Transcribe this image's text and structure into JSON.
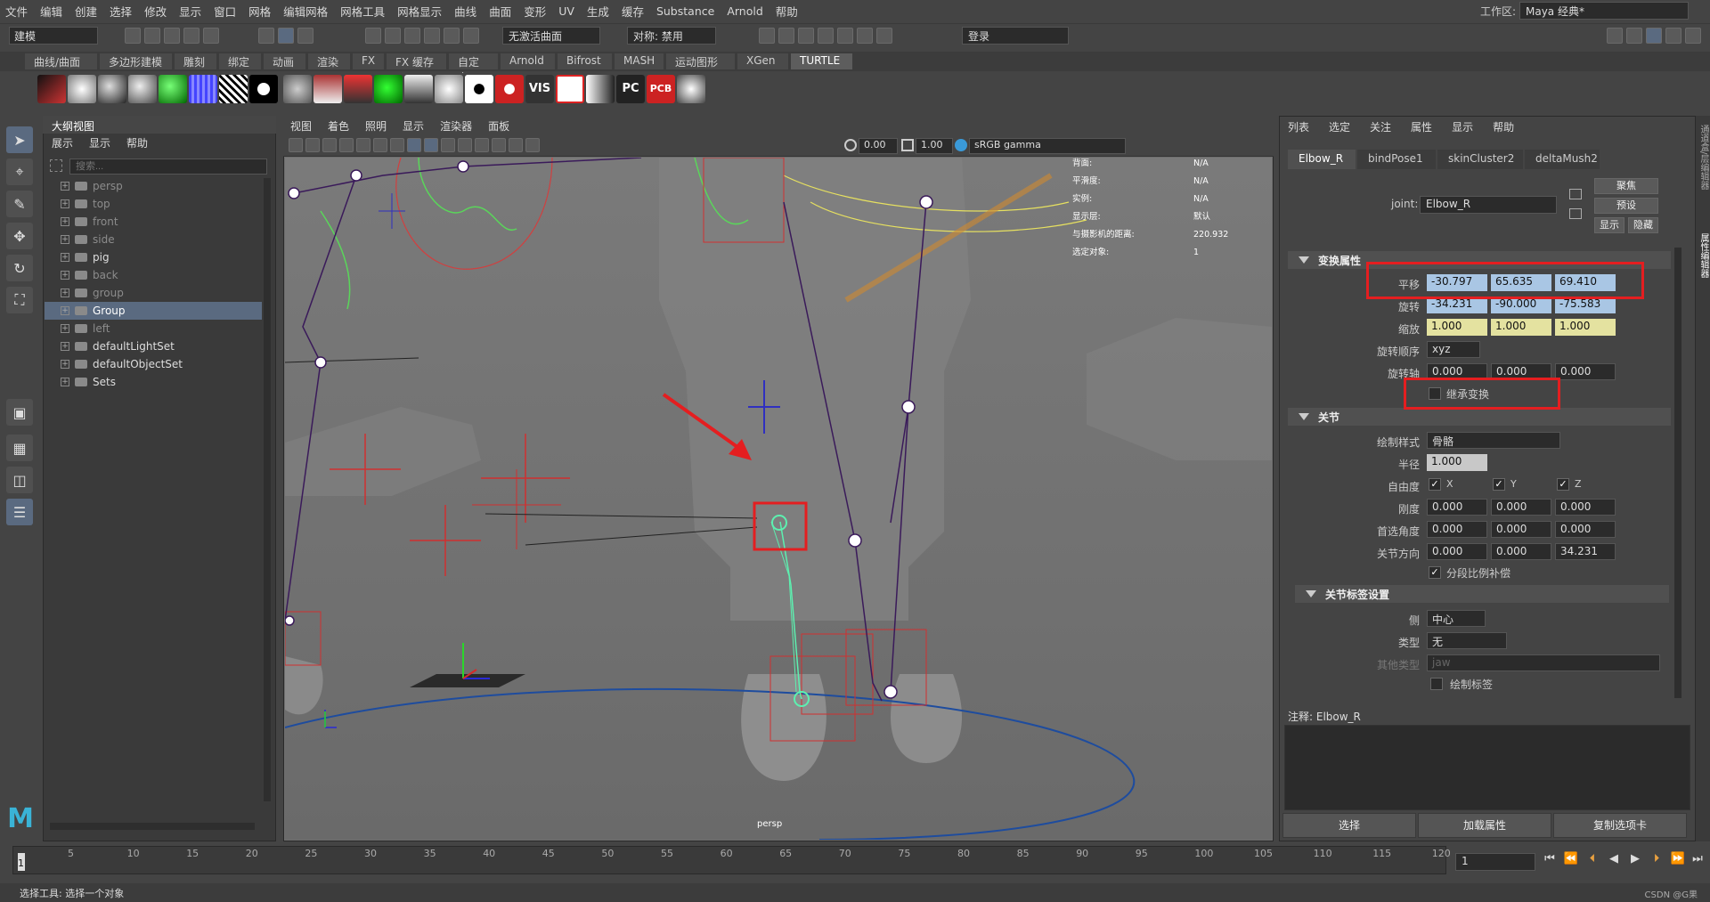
{
  "menubar": {
    "items": [
      "文件",
      "编辑",
      "创建",
      "选择",
      "修改",
      "显示",
      "窗口",
      "网格",
      "编辑网格",
      "网格工具",
      "网格显示",
      "曲线",
      "曲面",
      "变形",
      "UV",
      "生成",
      "缓存",
      "Substance",
      "Arnold",
      "帮助"
    ],
    "workspace_label": "工作区:",
    "workspace_value": "Maya 经典*"
  },
  "statusline": {
    "mode": "建模",
    "live_surface": "无激活曲面",
    "symmetry": "对称: 禁用",
    "login": "登录"
  },
  "shelf_tabs": [
    "曲线/曲面",
    "多边形建模",
    "雕刻",
    "绑定",
    "动画",
    "渲染",
    "FX",
    "FX 缓存",
    "自定义",
    "Arnold",
    "Bifrost",
    "MASH",
    "运动图形",
    "XGen",
    "TURTLE"
  ],
  "shelf_active": "TURTLE",
  "shelf_icon_labels": {
    "vis": "VIS",
    "pc": "PC",
    "pcb": "PCB"
  },
  "outliner": {
    "title": "大纲视图",
    "menu": [
      "展示",
      "显示",
      "帮助"
    ],
    "search_placeholder": "搜索...",
    "items": [
      {
        "label": "persp",
        "dim": true
      },
      {
        "label": "top",
        "dim": true
      },
      {
        "label": "front",
        "dim": true
      },
      {
        "label": "side",
        "dim": true
      },
      {
        "label": "pig",
        "dim": false
      },
      {
        "label": "back",
        "dim": true
      },
      {
        "label": "group",
        "dim": true
      },
      {
        "label": "Group",
        "dim": false,
        "selected": true
      },
      {
        "label": "left",
        "dim": true
      },
      {
        "label": "defaultLightSet",
        "dim": false
      },
      {
        "label": "defaultObjectSet",
        "dim": false
      },
      {
        "label": "Sets",
        "dim": false
      }
    ]
  },
  "viewport": {
    "menu": [
      "视图",
      "着色",
      "照明",
      "显示",
      "渲染器",
      "面板"
    ],
    "exposure": "0.00",
    "gamma": "1.00",
    "colorspace": "sRGB gamma",
    "camera_label": "persp",
    "hud": [
      {
        "label": "背面:",
        "value": "N/A"
      },
      {
        "label": "平滑度:",
        "value": "N/A"
      },
      {
        "label": "实例:",
        "value": "N/A"
      },
      {
        "label": "显示层:",
        "value": "默认"
      },
      {
        "label": "与摄影机的距离:",
        "value": "220.932"
      },
      {
        "label": "选定对象:",
        "value": "1"
      }
    ]
  },
  "attribute_editor": {
    "menu": [
      "列表",
      "选定",
      "关注",
      "属性",
      "显示",
      "帮助"
    ],
    "tabs": [
      "Elbow_R",
      "bindPose1",
      "skinCluster2",
      "deltaMush2"
    ],
    "joint_label": "joint:",
    "joint_name": "Elbow_R",
    "buttons": {
      "focus": "聚焦",
      "preset": "预设",
      "show": "显示",
      "hide": "隐藏"
    },
    "transform": {
      "title": "变换属性",
      "translate": {
        "label": "平移",
        "values": [
          "-30.797",
          "65.635",
          "69.410"
        ]
      },
      "rotate": {
        "label": "旋转",
        "values": [
          "-34.231",
          "-90.000",
          "-75.583"
        ]
      },
      "scale": {
        "label": "缩放",
        "values": [
          "1.000",
          "1.000",
          "1.000"
        ]
      },
      "rotate_order": {
        "label": "旋转顺序",
        "value": "xyz"
      },
      "rotate_axis": {
        "label": "旋转轴",
        "values": [
          "0.000",
          "0.000",
          "0.000"
        ]
      },
      "inherit": "继承变换"
    },
    "joint": {
      "title": "关节",
      "draw_style": {
        "label": "绘制样式",
        "value": "骨骼"
      },
      "radius": {
        "label": "半径",
        "value": "1.000"
      },
      "dof": {
        "label": "自由度",
        "axes": [
          "X",
          "Y",
          "Z"
        ]
      },
      "stiffness": {
        "label": "刚度",
        "values": [
          "0.000",
          "0.000",
          "0.000"
        ]
      },
      "pref_angle": {
        "label": "首选角度",
        "values": [
          "0.000",
          "0.000",
          "0.000"
        ]
      },
      "joint_orient": {
        "label": "关节方向",
        "values": [
          "0.000",
          "0.000",
          "34.231"
        ]
      },
      "seg_scale": "分段比例补偿"
    },
    "labelling": {
      "title": "关节标签设置",
      "side": {
        "label": "侧",
        "value": "中心"
      },
      "type": {
        "label": "类型",
        "value": "无"
      },
      "other": {
        "label": "其他类型",
        "value": "jaw"
      },
      "draw_label": "绘制标签"
    },
    "notes_label": "注释: Elbow_R",
    "bottom_buttons": [
      "选择",
      "加载属性",
      "复制选项卡"
    ]
  },
  "timeline": {
    "ticks": [
      "5",
      "10",
      "15",
      "20",
      "25",
      "30",
      "35",
      "40",
      "45",
      "50",
      "55",
      "60",
      "65",
      "70",
      "75",
      "80",
      "85",
      "90",
      "95",
      "100",
      "105",
      "110",
      "115",
      "120"
    ],
    "start": "1",
    "current_frame": "1"
  },
  "helpline": "选择工具: 选择一个对象",
  "watermark": "CSDN @G果",
  "right_strip": [
    "通道盒/层编辑器",
    "属性编辑器"
  ],
  "colors": {
    "accent": "#5a6a80",
    "highlight": "#e41e20",
    "translate_field": "#a9c6e4",
    "scale_field": "#e4e2a0",
    "bone_selected": "#5df0b0",
    "bone": "#3a1a5a"
  }
}
